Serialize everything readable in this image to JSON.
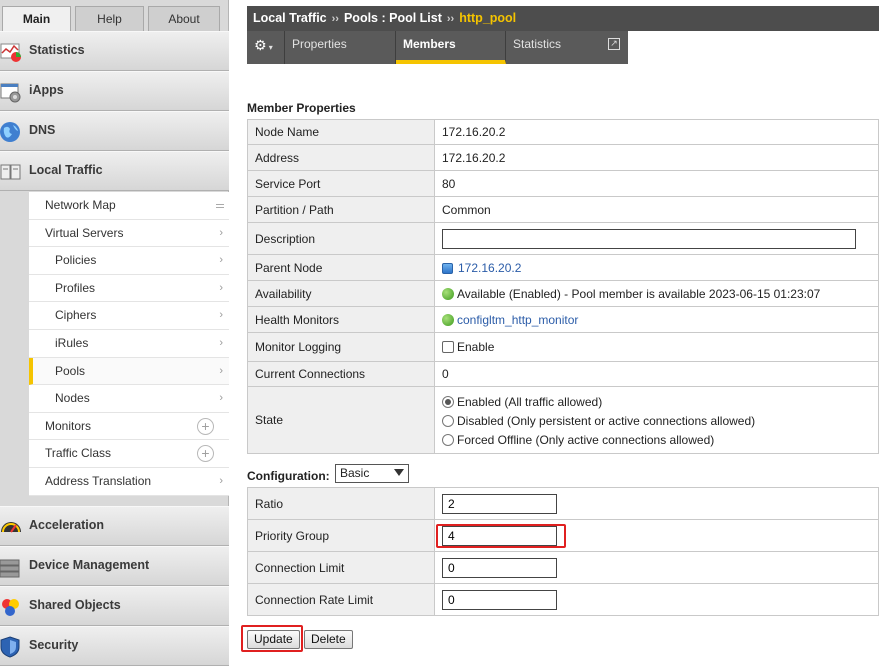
{
  "nav_tabs": {
    "main": "Main",
    "help": "Help",
    "about": "About"
  },
  "sections": {
    "statistics": "Statistics",
    "iapps": "iApps",
    "dns": "DNS",
    "local_traffic": "Local Traffic",
    "acceleration": "Acceleration",
    "device_management": "Device Management",
    "shared_objects": "Shared Objects",
    "security": "Security"
  },
  "local_traffic_menu": {
    "network_map": "Network Map",
    "virtual_servers": "Virtual Servers",
    "policies": "Policies",
    "profiles": "Profiles",
    "ciphers": "Ciphers",
    "irules": "iRules",
    "pools": "Pools",
    "nodes": "Nodes",
    "monitors": "Monitors",
    "traffic_class": "Traffic Class",
    "address_translation": "Address Translation"
  },
  "breadcrumb": {
    "part1": "Local Traffic",
    "sep": "››",
    "part2": "Pools : Pool List",
    "current": "http_pool"
  },
  "page_tabs": {
    "properties": "Properties",
    "members": "Members",
    "statistics": "Statistics"
  },
  "member_properties": {
    "title": "Member Properties",
    "node_name_label": "Node Name",
    "node_name": "172.16.20.2",
    "address_label": "Address",
    "address": "172.16.20.2",
    "service_port_label": "Service Port",
    "service_port": "80",
    "partition_label": "Partition / Path",
    "partition": "Common",
    "description_label": "Description",
    "description": "",
    "parent_node_label": "Parent Node",
    "parent_node": "172.16.20.2",
    "availability_label": "Availability",
    "availability": "Available (Enabled) - Pool member is available 2023-06-15 01:23:07",
    "health_monitors_label": "Health Monitors",
    "health_monitor": "configltm_http_monitor",
    "monitor_logging_label": "Monitor Logging",
    "monitor_logging_option": "Enable",
    "current_connections_label": "Current Connections",
    "current_connections": "0",
    "state_label": "State",
    "state_options": [
      "Enabled (All traffic allowed)",
      "Disabled (Only persistent or active connections allowed)",
      "Forced Offline (Only active connections allowed)"
    ]
  },
  "configuration": {
    "label": "Configuration:",
    "mode": "Basic",
    "ratio_label": "Ratio",
    "ratio": "2",
    "priority_group_label": "Priority Group",
    "priority_group": "4",
    "connection_limit_label": "Connection Limit",
    "connection_limit": "0",
    "connection_rate_limit_label": "Connection Rate Limit",
    "connection_rate_limit": "0"
  },
  "buttons": {
    "update": "Update",
    "delete": "Delete"
  },
  "colors": {
    "accent": "#f5c400",
    "highlight": "#e02020",
    "link": "#2b5ca8",
    "header_bg": "#4d4d4d"
  }
}
